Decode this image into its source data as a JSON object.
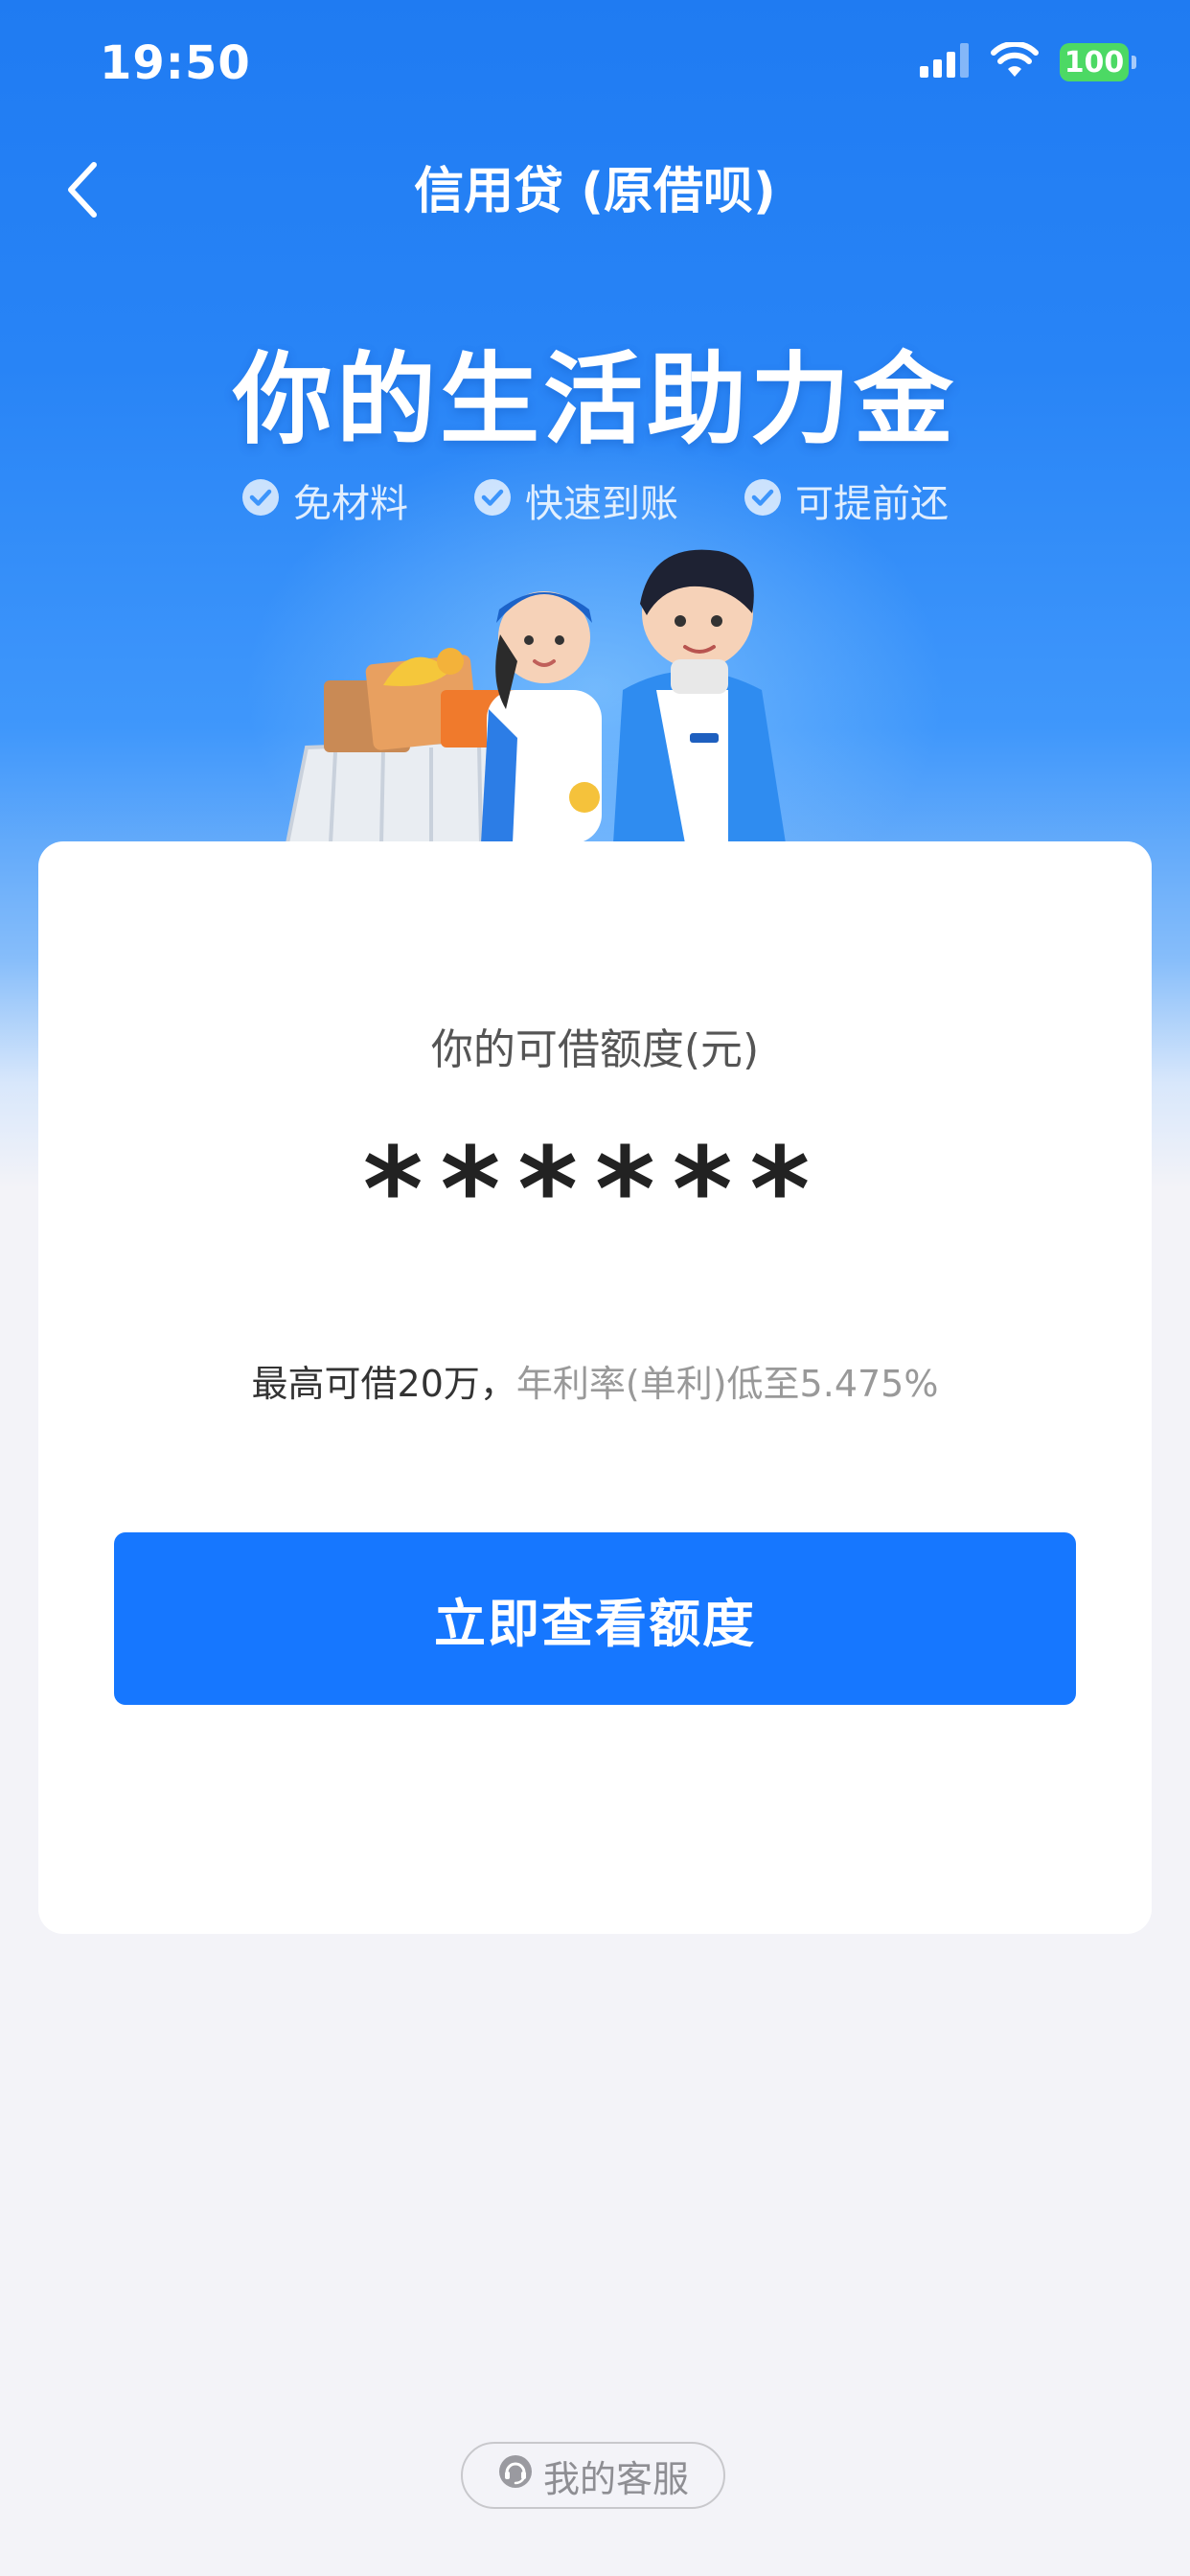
{
  "status_bar": {
    "time": "19:50",
    "battery": "100",
    "icons": [
      "signal-icon",
      "wifi-icon",
      "battery-icon"
    ]
  },
  "nav": {
    "title": "信用贷 (原借呗)",
    "back_icon": "chevron-left-icon"
  },
  "hero": {
    "title": "你的生活助力金",
    "features": [
      {
        "label": "免材料",
        "icon": "check-circle-icon"
      },
      {
        "label": "快速到账",
        "icon": "check-circle-icon"
      },
      {
        "label": "可提前还",
        "icon": "check-circle-icon"
      }
    ],
    "illustration": "shopping-couple-illustration"
  },
  "card": {
    "quota_label": "你的可借额度(元)",
    "quota_masked": "******",
    "limit_main": "最高可借20万，",
    "limit_rate": "年利率(单利)低至5.475%",
    "cta_label": "立即查看额度"
  },
  "footer": {
    "service_label": "我的客服",
    "service_icon": "headset-icon"
  },
  "colors": {
    "primary": "#1677ff",
    "header_top": "#1f7bf2",
    "background": "#f3f3f8",
    "battery": "#4cd964"
  }
}
